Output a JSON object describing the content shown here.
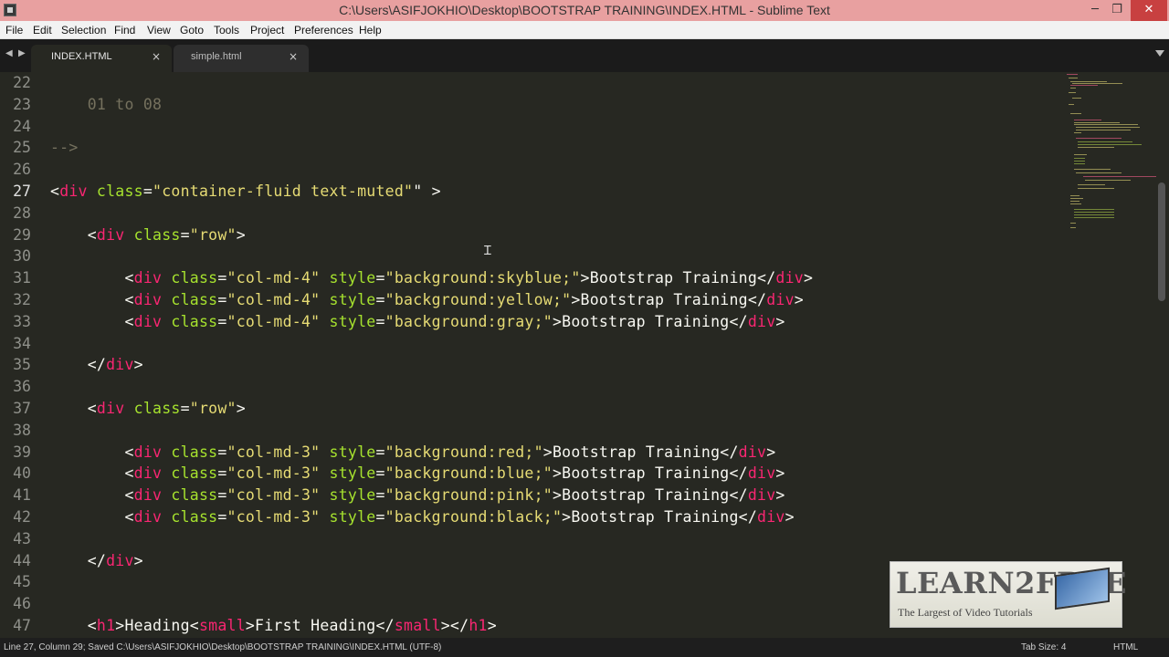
{
  "window": {
    "title": "C:\\Users\\ASIFJOKHIO\\Desktop\\BOOTSTRAP TRAINING\\INDEX.HTML - Sublime Text",
    "minimize_glyph": "─",
    "maximize_glyph": "❐",
    "close_glyph": "✕"
  },
  "menu": {
    "items": [
      "File",
      "Edit",
      "Selection",
      "Find",
      "View",
      "Goto",
      "Tools",
      "Project",
      "Preferences",
      "Help"
    ]
  },
  "tabs": [
    {
      "label": "INDEX.HTML",
      "active": true
    },
    {
      "label": "simple.html",
      "active": false
    }
  ],
  "editor": {
    "current_line": 27,
    "lines": [
      {
        "num": "22",
        "tokens": []
      },
      {
        "num": "23",
        "tokens": [
          {
            "t": "    01 to 08",
            "c": "comment"
          }
        ]
      },
      {
        "num": "24",
        "tokens": []
      },
      {
        "num": "25",
        "tokens": [
          {
            "t": "-->",
            "c": "comment"
          }
        ]
      },
      {
        "num": "26",
        "tokens": []
      },
      {
        "num": "27",
        "tokens": [
          {
            "t": "<",
            "c": "bracket"
          },
          {
            "t": "div",
            "c": "tag"
          },
          {
            "t": " class",
            "c": "attr"
          },
          {
            "t": "=",
            "c": "text"
          },
          {
            "t": "\"container-fluid text-muted\"",
            "c": "str"
          },
          {
            "t": "\" >",
            "c": "text"
          }
        ]
      },
      {
        "num": "28",
        "tokens": []
      },
      {
        "num": "29",
        "tokens": [
          {
            "t": "    <",
            "c": "bracket"
          },
          {
            "t": "div",
            "c": "tag"
          },
          {
            "t": " class",
            "c": "attr"
          },
          {
            "t": "=",
            "c": "text"
          },
          {
            "t": "\"row\"",
            "c": "str"
          },
          {
            "t": ">",
            "c": "bracket"
          }
        ]
      },
      {
        "num": "30",
        "tokens": []
      },
      {
        "num": "31",
        "tokens": [
          {
            "t": "        <",
            "c": "bracket"
          },
          {
            "t": "div",
            "c": "tag"
          },
          {
            "t": " class",
            "c": "attr"
          },
          {
            "t": "=",
            "c": "text"
          },
          {
            "t": "\"col-md-4\"",
            "c": "str"
          },
          {
            "t": " style",
            "c": "attr"
          },
          {
            "t": "=",
            "c": "text"
          },
          {
            "t": "\"background:skyblue;\"",
            "c": "str"
          },
          {
            "t": ">Bootstrap Training</",
            "c": "text"
          },
          {
            "t": "div",
            "c": "tag"
          },
          {
            "t": ">",
            "c": "bracket"
          }
        ]
      },
      {
        "num": "32",
        "tokens": [
          {
            "t": "        <",
            "c": "bracket"
          },
          {
            "t": "div",
            "c": "tag"
          },
          {
            "t": " class",
            "c": "attr"
          },
          {
            "t": "=",
            "c": "text"
          },
          {
            "t": "\"col-md-4\"",
            "c": "str"
          },
          {
            "t": " style",
            "c": "attr"
          },
          {
            "t": "=",
            "c": "text"
          },
          {
            "t": "\"background:yellow;\"",
            "c": "str"
          },
          {
            "t": ">Bootstrap Training</",
            "c": "text"
          },
          {
            "t": "div",
            "c": "tag"
          },
          {
            "t": ">",
            "c": "bracket"
          }
        ]
      },
      {
        "num": "33",
        "tokens": [
          {
            "t": "        <",
            "c": "bracket"
          },
          {
            "t": "div",
            "c": "tag"
          },
          {
            "t": " class",
            "c": "attr"
          },
          {
            "t": "=",
            "c": "text"
          },
          {
            "t": "\"col-md-4\"",
            "c": "str"
          },
          {
            "t": " style",
            "c": "attr"
          },
          {
            "t": "=",
            "c": "text"
          },
          {
            "t": "\"background:gray;\"",
            "c": "str"
          },
          {
            "t": ">Bootstrap Training</",
            "c": "text"
          },
          {
            "t": "div",
            "c": "tag"
          },
          {
            "t": ">",
            "c": "bracket"
          }
        ]
      },
      {
        "num": "34",
        "tokens": []
      },
      {
        "num": "35",
        "tokens": [
          {
            "t": "    </",
            "c": "bracket"
          },
          {
            "t": "div",
            "c": "tag"
          },
          {
            "t": ">",
            "c": "bracket"
          }
        ]
      },
      {
        "num": "36",
        "tokens": []
      },
      {
        "num": "37",
        "tokens": [
          {
            "t": "    <",
            "c": "bracket"
          },
          {
            "t": "div",
            "c": "tag"
          },
          {
            "t": " class",
            "c": "attr"
          },
          {
            "t": "=",
            "c": "text"
          },
          {
            "t": "\"row\"",
            "c": "str"
          },
          {
            "t": ">",
            "c": "bracket"
          }
        ]
      },
      {
        "num": "38",
        "tokens": []
      },
      {
        "num": "39",
        "tokens": [
          {
            "t": "        <",
            "c": "bracket"
          },
          {
            "t": "div",
            "c": "tag"
          },
          {
            "t": " class",
            "c": "attr"
          },
          {
            "t": "=",
            "c": "text"
          },
          {
            "t": "\"col-md-3\"",
            "c": "str"
          },
          {
            "t": " style",
            "c": "attr"
          },
          {
            "t": "=",
            "c": "text"
          },
          {
            "t": "\"background:red;\"",
            "c": "str"
          },
          {
            "t": ">Bootstrap Training</",
            "c": "text"
          },
          {
            "t": "div",
            "c": "tag"
          },
          {
            "t": ">",
            "c": "bracket"
          }
        ]
      },
      {
        "num": "40",
        "tokens": [
          {
            "t": "        <",
            "c": "bracket"
          },
          {
            "t": "div",
            "c": "tag"
          },
          {
            "t": " class",
            "c": "attr"
          },
          {
            "t": "=",
            "c": "text"
          },
          {
            "t": "\"col-md-3\"",
            "c": "str"
          },
          {
            "t": " style",
            "c": "attr"
          },
          {
            "t": "=",
            "c": "text"
          },
          {
            "t": "\"background:blue;\"",
            "c": "str"
          },
          {
            "t": ">Bootstrap Training</",
            "c": "text"
          },
          {
            "t": "div",
            "c": "tag"
          },
          {
            "t": ">",
            "c": "bracket"
          }
        ]
      },
      {
        "num": "41",
        "tokens": [
          {
            "t": "        <",
            "c": "bracket"
          },
          {
            "t": "div",
            "c": "tag"
          },
          {
            "t": " class",
            "c": "attr"
          },
          {
            "t": "=",
            "c": "text"
          },
          {
            "t": "\"col-md-3\"",
            "c": "str"
          },
          {
            "t": " style",
            "c": "attr"
          },
          {
            "t": "=",
            "c": "text"
          },
          {
            "t": "\"background:pink;\"",
            "c": "str"
          },
          {
            "t": ">Bootstrap Training</",
            "c": "text"
          },
          {
            "t": "div",
            "c": "tag"
          },
          {
            "t": ">",
            "c": "bracket"
          }
        ]
      },
      {
        "num": "42",
        "tokens": [
          {
            "t": "        <",
            "c": "bracket"
          },
          {
            "t": "div",
            "c": "tag"
          },
          {
            "t": " class",
            "c": "attr"
          },
          {
            "t": "=",
            "c": "text"
          },
          {
            "t": "\"col-md-3\"",
            "c": "str"
          },
          {
            "t": " style",
            "c": "attr"
          },
          {
            "t": "=",
            "c": "text"
          },
          {
            "t": "\"background:black;\"",
            "c": "str"
          },
          {
            "t": ">Bootstrap Training</",
            "c": "text"
          },
          {
            "t": "div",
            "c": "tag"
          },
          {
            "t": ">",
            "c": "bracket"
          }
        ]
      },
      {
        "num": "43",
        "tokens": []
      },
      {
        "num": "44",
        "tokens": [
          {
            "t": "    </",
            "c": "bracket"
          },
          {
            "t": "div",
            "c": "tag"
          },
          {
            "t": ">",
            "c": "bracket"
          }
        ]
      },
      {
        "num": "45",
        "tokens": []
      },
      {
        "num": "46",
        "tokens": []
      },
      {
        "num": "47",
        "tokens": [
          {
            "t": "    <",
            "c": "bracket"
          },
          {
            "t": "h1",
            "c": "tag"
          },
          {
            "t": ">Heading<",
            "c": "text"
          },
          {
            "t": "small",
            "c": "tag"
          },
          {
            "t": ">First Heading</",
            "c": "text"
          },
          {
            "t": "small",
            "c": "tag"
          },
          {
            "t": "></",
            "c": "text"
          },
          {
            "t": "h1",
            "c": "tag"
          },
          {
            "t": ">",
            "c": "bracket"
          }
        ]
      }
    ]
  },
  "watermark": {
    "title": "LEARN2FREE",
    "subtitle": "The Largest of Video Tutorials"
  },
  "statusbar": {
    "status": "Line 27, Column 29; Saved C:\\Users\\ASIFJOKHIO\\Desktop\\BOOTSTRAP TRAINING\\INDEX.HTML (UTF-8)",
    "tab_size": "Tab Size: 4",
    "syntax": "HTML"
  },
  "colors": {
    "titlebar": "#e8a0a0",
    "editor_bg": "#272822",
    "tag": "#f92672",
    "attr": "#a6e22e",
    "string": "#e6db74",
    "comment": "#75715e"
  }
}
